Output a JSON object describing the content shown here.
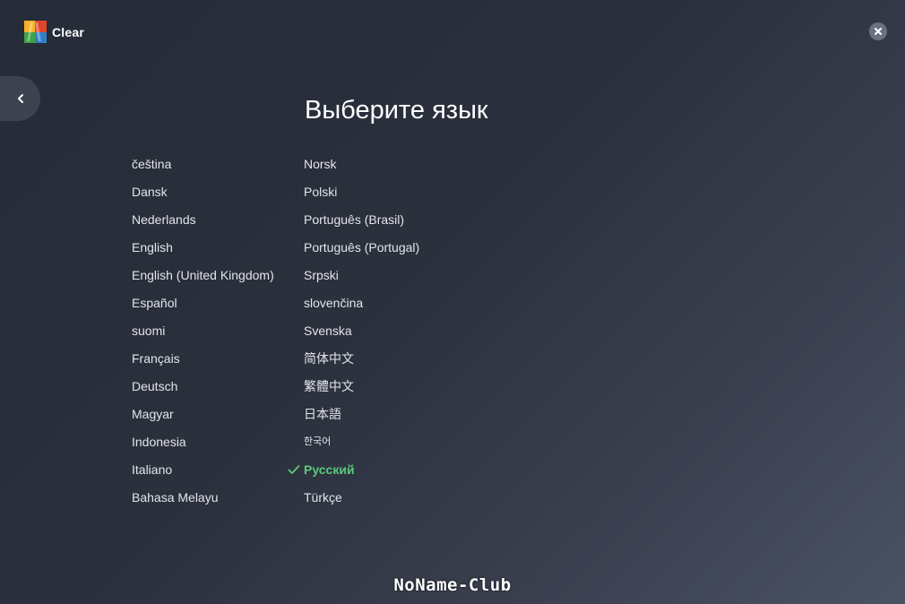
{
  "app": {
    "name": "Clear",
    "logo_colors": [
      "#f4b228",
      "#e0452b",
      "#3ea249",
      "#2f80c6"
    ]
  },
  "header": {
    "close_icon": "close-icon",
    "back_icon": "chevron-left-icon"
  },
  "main": {
    "title": "Выберите язык",
    "selected_color": "#5ac978",
    "columns": [
      {
        "items": [
          {
            "label": "čeština"
          },
          {
            "label": "Dansk"
          },
          {
            "label": "Nederlands"
          },
          {
            "label": "English"
          },
          {
            "label": "English (United Kingdom)"
          },
          {
            "label": "Español"
          },
          {
            "label": "suomi"
          },
          {
            "label": "Français"
          },
          {
            "label": "Deutsch"
          },
          {
            "label": "Magyar"
          },
          {
            "label": "Indonesia"
          },
          {
            "label": "Italiano"
          },
          {
            "label": "Bahasa Melayu"
          }
        ]
      },
      {
        "items": [
          {
            "label": "Norsk"
          },
          {
            "label": "Polski"
          },
          {
            "label": "Português (Brasil)"
          },
          {
            "label": "Português (Portugal)"
          },
          {
            "label": "Srpski"
          },
          {
            "label": "slovenčina"
          },
          {
            "label": "Svenska"
          },
          {
            "label": "简体中文"
          },
          {
            "label": "繁體中文"
          },
          {
            "label": "日本語"
          },
          {
            "label": "한국어"
          },
          {
            "label": "Русский",
            "selected": true
          },
          {
            "label": "Türkçe"
          }
        ]
      }
    ]
  },
  "watermark": "NoName-Club"
}
